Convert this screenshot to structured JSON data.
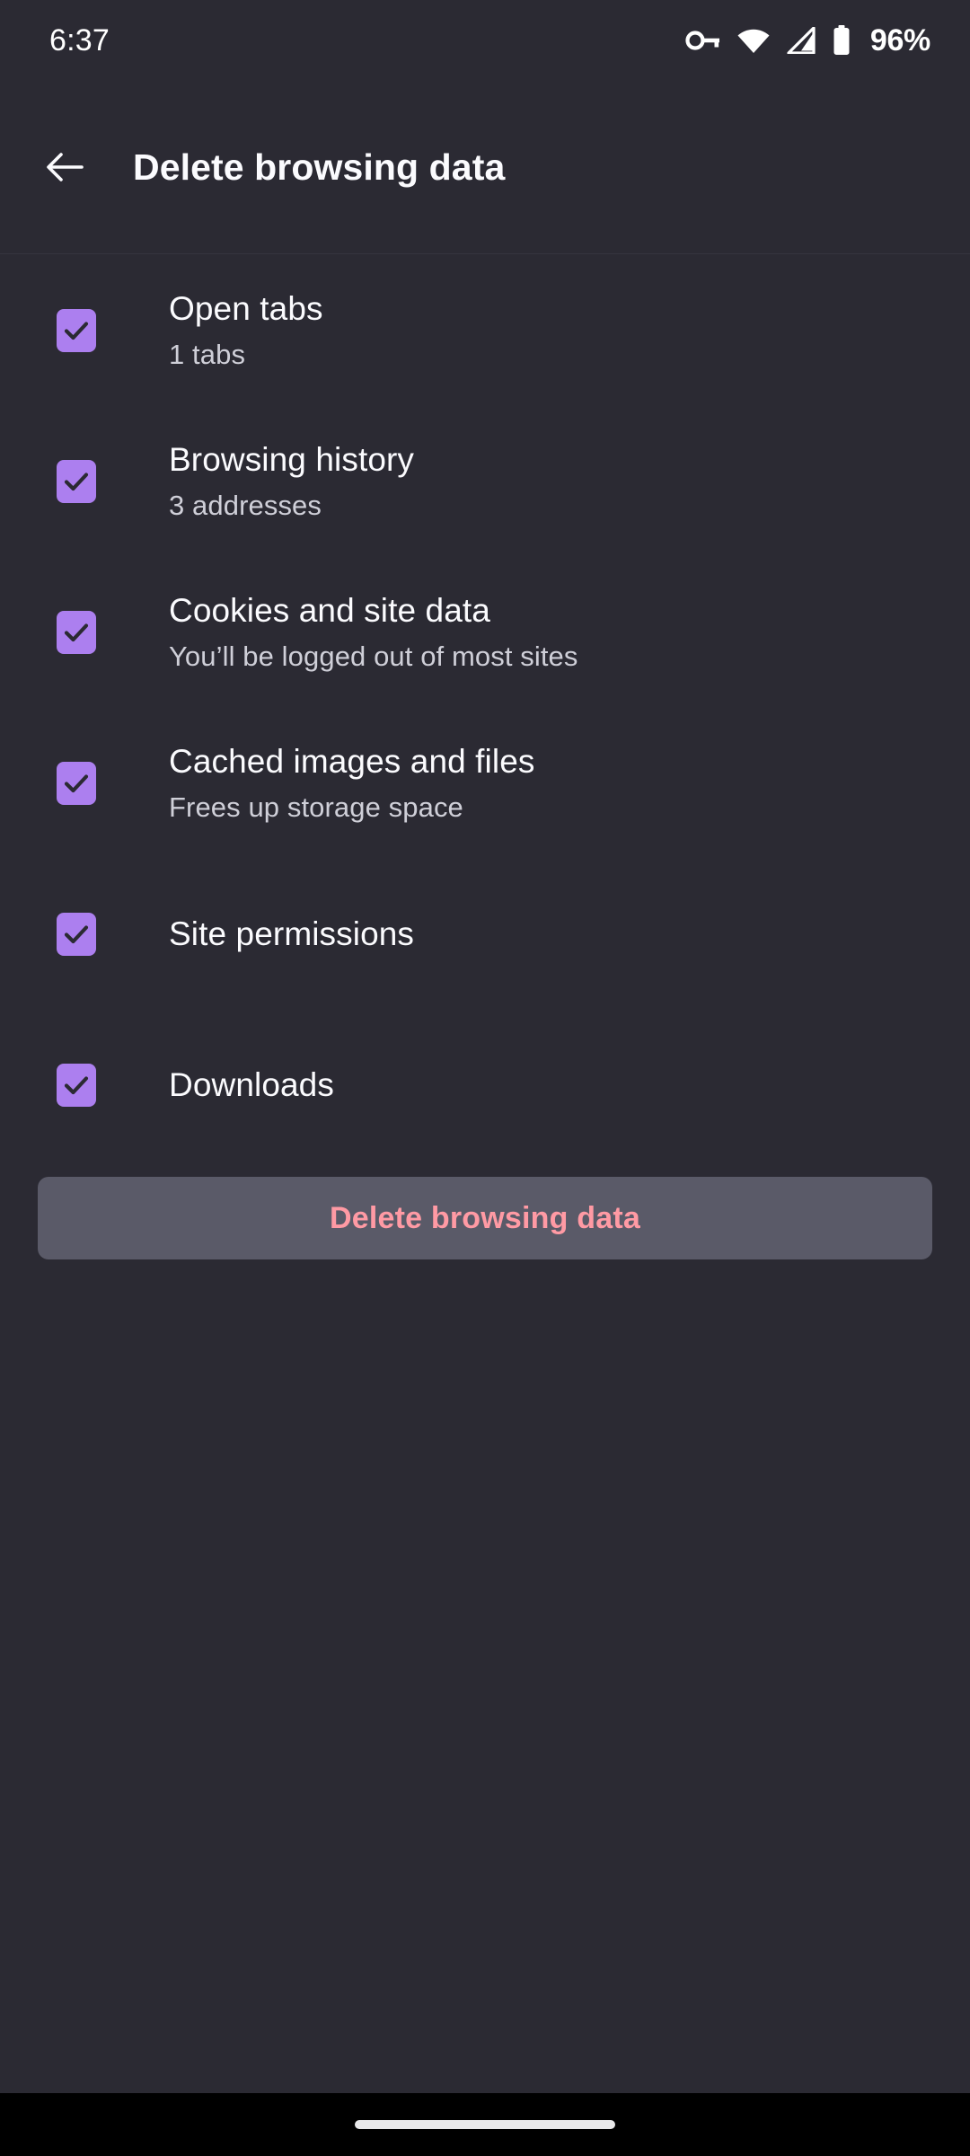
{
  "status_bar": {
    "time": "6:37",
    "battery_percent": "96%",
    "icons": [
      "vpn-key-icon",
      "wifi-icon",
      "cellular-signal-icon",
      "battery-icon"
    ]
  },
  "toolbar": {
    "back_icon": "arrow-left-icon",
    "title": "Delete browsing data"
  },
  "colors": {
    "background": "#2b2a33",
    "checkbox_accent": "#ac7fef",
    "checkmark": "#2b2a33",
    "title_text": "#fbfbfe",
    "subtitle_text": "#cfcfd8",
    "button_background": "#5a5a68",
    "button_text": "#ff9aa4",
    "nav_bar": "#000000",
    "divider": "#35343e"
  },
  "items": [
    {
      "title": "Open tabs",
      "subtitle": "1 tabs",
      "checked": true
    },
    {
      "title": "Browsing history",
      "subtitle": "3 addresses",
      "checked": true
    },
    {
      "title": "Cookies and site data",
      "subtitle": "You’ll be logged out of most sites",
      "checked": true
    },
    {
      "title": "Cached images and files",
      "subtitle": "Frees up storage space",
      "checked": true
    },
    {
      "title": "Site permissions",
      "subtitle": "",
      "checked": true
    },
    {
      "title": "Downloads",
      "subtitle": "",
      "checked": true
    }
  ],
  "action_button": {
    "label": "Delete browsing data"
  },
  "nav_bar": {
    "handle": "gesture-pill-handle"
  }
}
